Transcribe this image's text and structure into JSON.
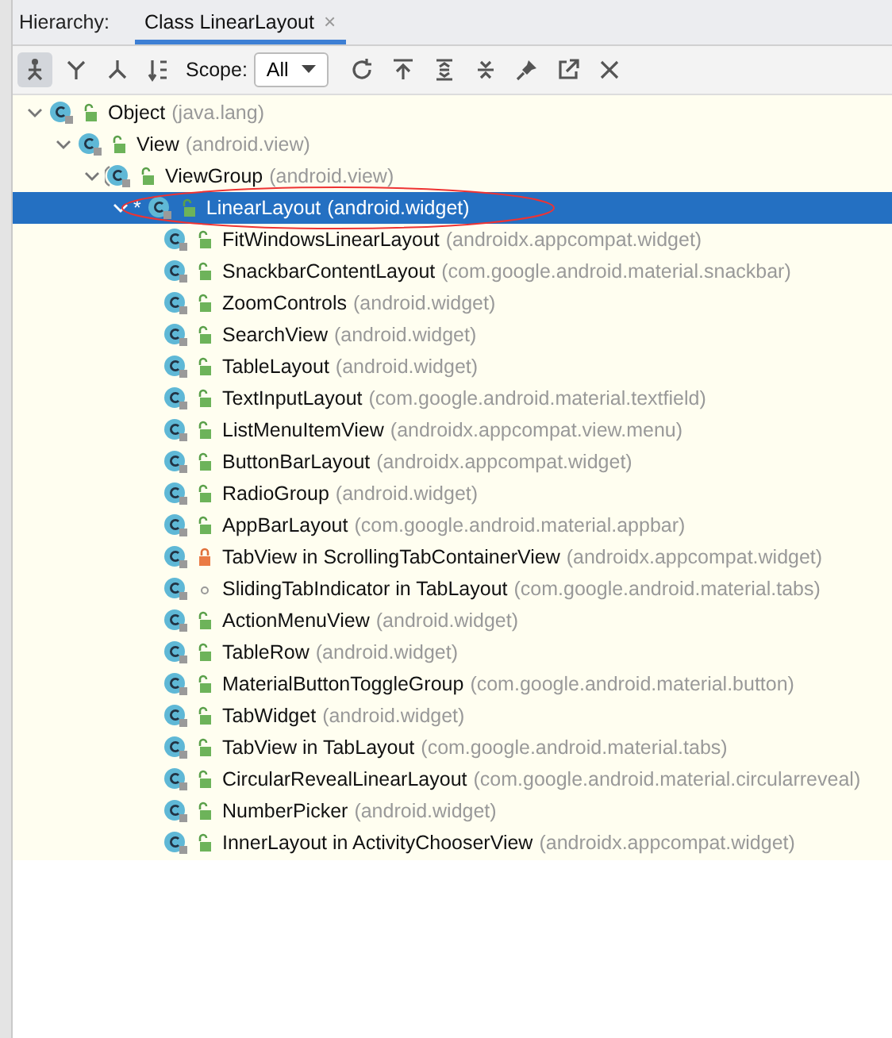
{
  "header": {
    "label": "Hierarchy:",
    "tabs": [
      {
        "label": "Class LinearLayout",
        "selected": true,
        "close": "×"
      }
    ]
  },
  "toolbar": {
    "scope_label": "Scope:",
    "scope_value": "All"
  },
  "tree": [
    {
      "name": "Object",
      "package": "(java.lang)",
      "kind": "public",
      "expanded": true,
      "selected": false,
      "children": [
        {
          "name": "View",
          "package": "(android.view)",
          "kind": "public",
          "expanded": true,
          "selected": false,
          "children": [
            {
              "name": "ViewGroup",
              "package": "(android.view)",
              "abstract": true,
              "kind": "public",
              "expanded": true,
              "selected": false,
              "children": [
                {
                  "name": "LinearLayout",
                  "package": "(android.widget)",
                  "marker": "*",
                  "kind": "public",
                  "expanded": true,
                  "selected": true,
                  "children": [
                    {
                      "name": "FitWindowsLinearLayout",
                      "package": "(androidx.appcompat.widget)",
                      "kind": "public",
                      "selected": false
                    },
                    {
                      "name": "SnackbarContentLayout",
                      "package": "(com.google.android.material.snackbar)",
                      "kind": "public",
                      "selected": false
                    },
                    {
                      "name": "ZoomControls",
                      "package": "(android.widget)",
                      "kind": "public",
                      "selected": false
                    },
                    {
                      "name": "SearchView",
                      "package": "(android.widget)",
                      "kind": "public",
                      "selected": false
                    },
                    {
                      "name": "TableLayout",
                      "package": "(android.widget)",
                      "kind": "public",
                      "selected": false
                    },
                    {
                      "name": "TextInputLayout",
                      "package": "(com.google.android.material.textfield)",
                      "kind": "public",
                      "selected": false
                    },
                    {
                      "name": "ListMenuItemView",
                      "package": "(androidx.appcompat.view.menu)",
                      "kind": "public",
                      "selected": false
                    },
                    {
                      "name": "ButtonBarLayout",
                      "package": "(androidx.appcompat.widget)",
                      "kind": "public",
                      "selected": false
                    },
                    {
                      "name": "RadioGroup",
                      "package": "(android.widget)",
                      "kind": "public",
                      "selected": false
                    },
                    {
                      "name": "AppBarLayout",
                      "package": "(com.google.android.material.appbar)",
                      "kind": "public",
                      "selected": false
                    },
                    {
                      "name": "TabView in ScrollingTabContainerView",
                      "package": "(androidx.appcompat.widget)",
                      "kind": "private",
                      "selected": false
                    },
                    {
                      "name": "SlidingTabIndicator in TabLayout",
                      "package": "(com.google.android.material.tabs)",
                      "kind": "package",
                      "selected": false
                    },
                    {
                      "name": "ActionMenuView",
                      "package": "(android.widget)",
                      "kind": "public",
                      "selected": false
                    },
                    {
                      "name": "TableRow",
                      "package": "(android.widget)",
                      "kind": "public",
                      "selected": false
                    },
                    {
                      "name": "MaterialButtonToggleGroup",
                      "package": "(com.google.android.material.button)",
                      "kind": "public",
                      "selected": false
                    },
                    {
                      "name": "TabWidget",
                      "package": "(android.widget)",
                      "kind": "public",
                      "selected": false
                    },
                    {
                      "name": "TabView in TabLayout",
                      "package": "(com.google.android.material.tabs)",
                      "kind": "public",
                      "selected": false
                    },
                    {
                      "name": "CircularRevealLinearLayout",
                      "package": "(com.google.android.material.circularreveal)",
                      "kind": "public",
                      "selected": false
                    },
                    {
                      "name": "NumberPicker",
                      "package": "(android.widget)",
                      "kind": "public",
                      "selected": false
                    },
                    {
                      "name": "InnerLayout in ActivityChooserView",
                      "package": "(androidx.appcompat.widget)",
                      "kind": "public",
                      "selected": false
                    }
                  ]
                }
              ]
            }
          ]
        }
      ]
    }
  ]
}
